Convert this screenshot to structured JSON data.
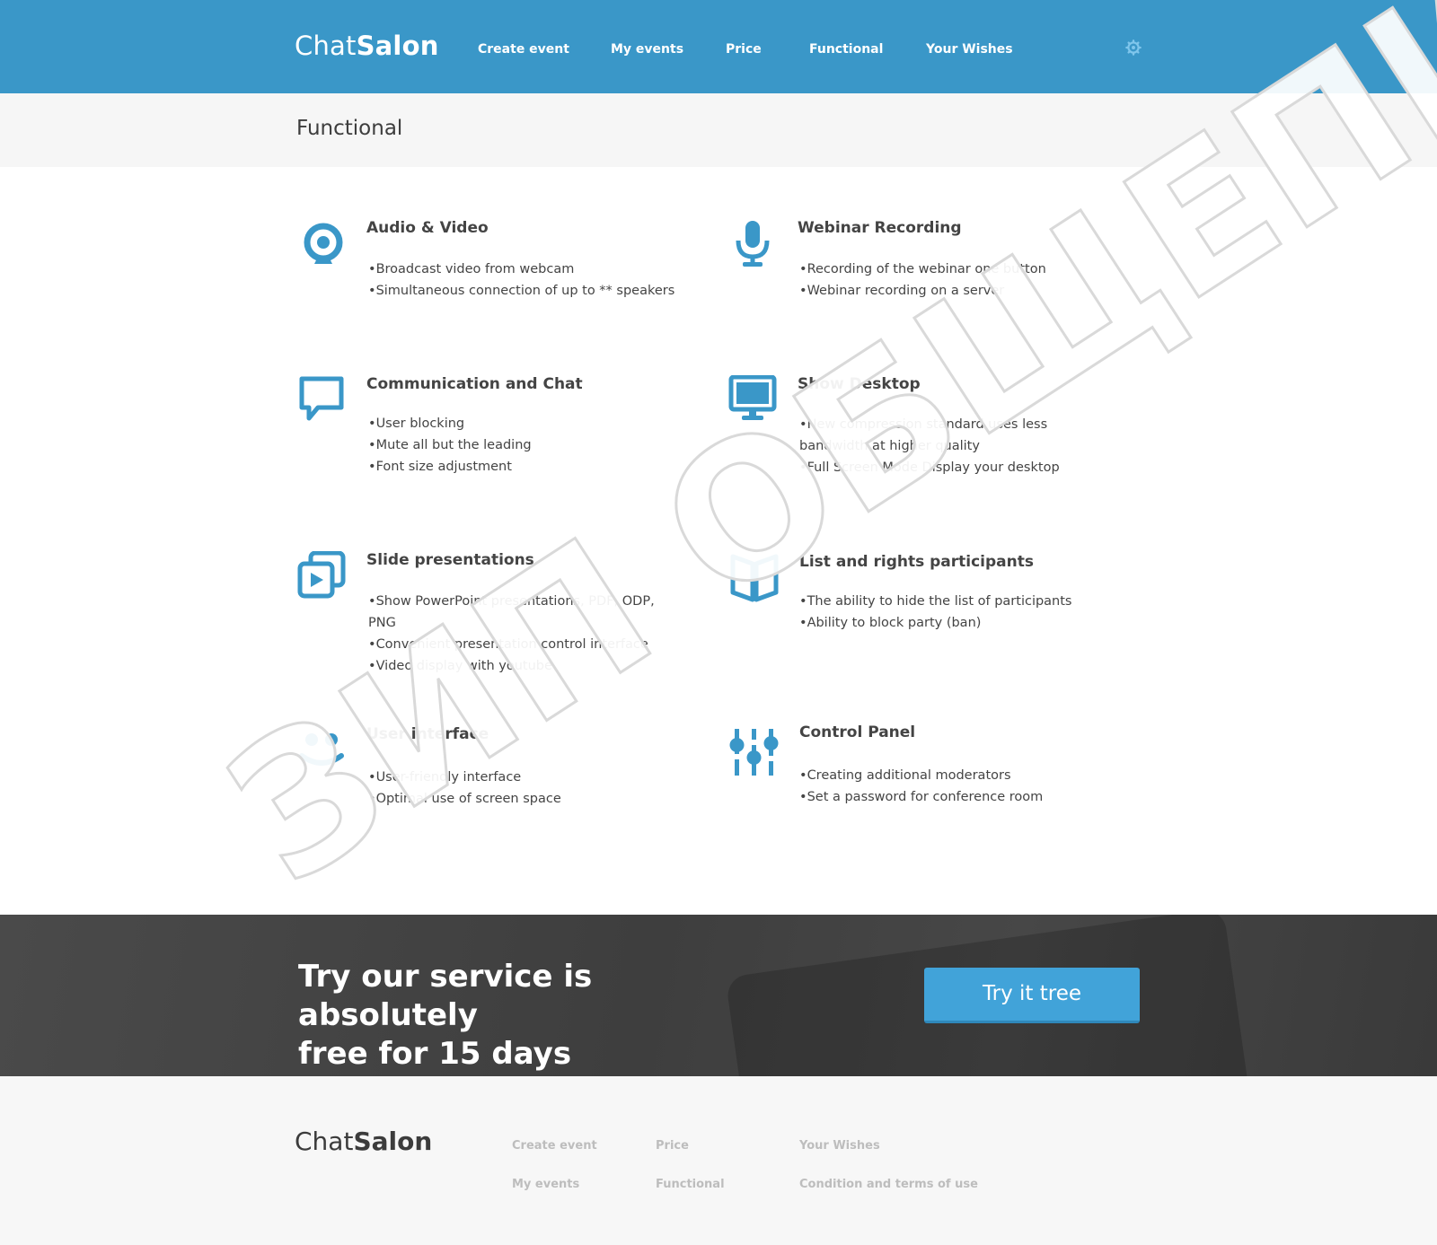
{
  "brand": {
    "light": "Chat",
    "bold": "Salon"
  },
  "nav": [
    {
      "label": "Create event"
    },
    {
      "label": "My events"
    },
    {
      "label": "Price"
    },
    {
      "label": "Functional"
    },
    {
      "label": "Your Wishes"
    }
  ],
  "page_title": "Functional",
  "features": [
    {
      "icon": "webcam-icon",
      "title": "Audio & Video",
      "items": [
        "Broadcast video from webcam",
        "Simultaneous connection of up to ** speakers"
      ]
    },
    {
      "icon": "microphone-icon",
      "title": "Webinar Recording",
      "items": [
        "Recording of the webinar one button",
        "Webinar recording on a server"
      ]
    },
    {
      "icon": "chat-bubble-icon",
      "title": "Communication and Chat",
      "items": [
        "User blocking",
        "Mute all but the leading",
        "Font size adjustment"
      ]
    },
    {
      "icon": "monitor-icon",
      "title": "Show Desktop",
      "items": [
        "New compression standard uses less bandwidth at higher quality",
        "Full Screen Mode Display your desktop"
      ]
    },
    {
      "icon": "slides-play-icon",
      "title": "Slide presentations",
      "items": [
        "Show PowerPoint presentations, PDF, ODP, PNG",
        "Convenient presentation control interface",
        "Video display with youtube"
      ]
    },
    {
      "icon": "open-book-icon",
      "title": "List and rights participants",
      "items": [
        "The ability to hide the list of participants",
        "Ability to block party (ban)"
      ]
    },
    {
      "icon": "smiley-icon",
      "title": "User interface",
      "items": [
        "User-friendly interface",
        "Optimal use of screen space"
      ]
    },
    {
      "icon": "sliders-icon",
      "title": "Control Panel",
      "items": [
        "Creating additional moderators",
        "Set a password for conference room"
      ]
    }
  ],
  "cta": {
    "line1": "Try our service is absolutely",
    "line2": "free for 15 days",
    "button": "Try it tree"
  },
  "footer": {
    "links": [
      "Create event",
      "My events",
      "Price",
      "Functional",
      "Your Wishes",
      "Condition and terms of use"
    ]
  },
  "watermark": "ЗИП ОБЩЕПИТ",
  "colors": {
    "header": "#3a97c8",
    "accent": "#3a97c8",
    "cta_button": "#41a3d9",
    "cta_band": "#414141"
  }
}
